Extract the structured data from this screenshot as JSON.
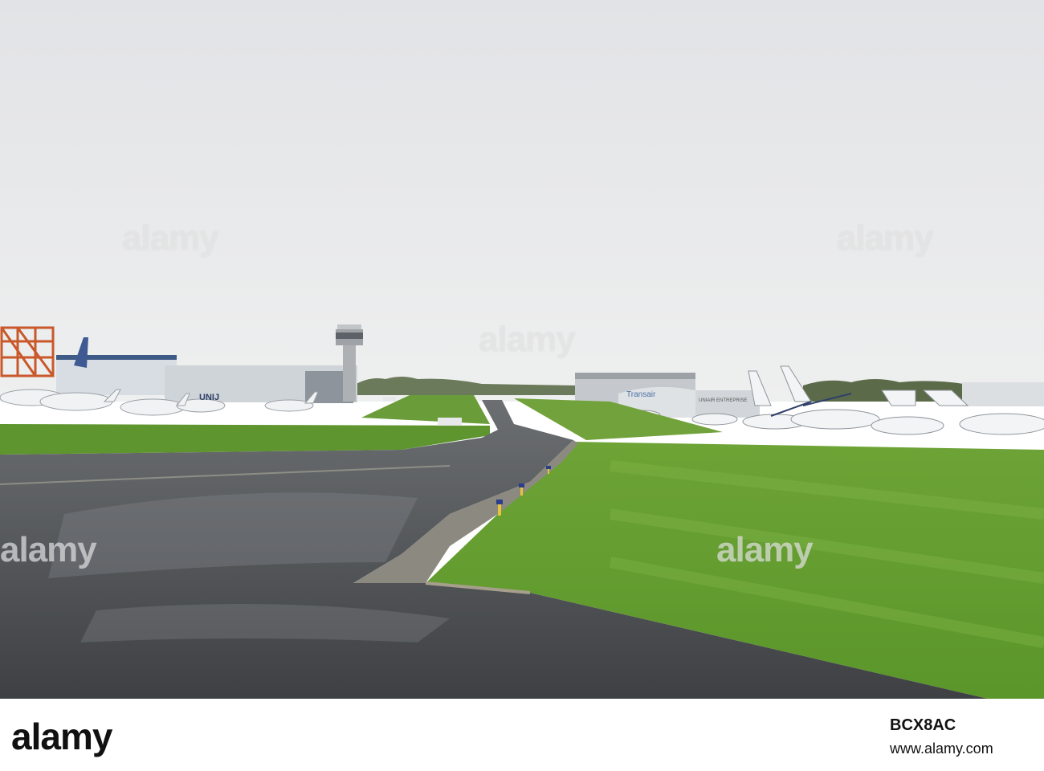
{
  "photo": {
    "watermark_text": "alamy",
    "sign_unijet": "UNIJ",
    "sign_transair": "Transair",
    "sign_hangar": "UNIAIR ENTREPRISE"
  },
  "footer": {
    "logo": "alamy",
    "image_id": "BCX8AC",
    "url": "www.alamy.com"
  },
  "colors": {
    "sky": "#e8e9eb",
    "grass": "#5f9a2c",
    "tarmac": "#4a4c4f",
    "footer_bg": "#ffffff"
  }
}
